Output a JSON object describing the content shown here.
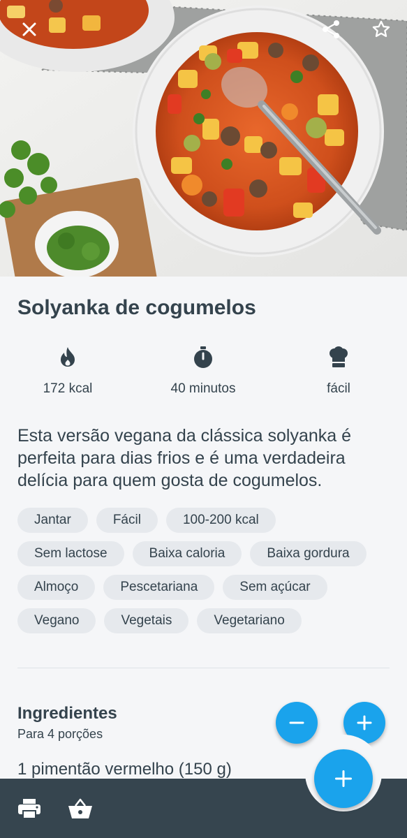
{
  "recipe": {
    "title": "Solyanka de cogumelos",
    "stats": {
      "calories": "172 kcal",
      "time": "40 minutos",
      "difficulty": "fácil"
    },
    "description": "Esta versão vegana da clássica solyanka é perfeita para dias frios e é uma verdadeira delícia para quem gosta de cogumelos.",
    "tags": [
      [
        "Jantar",
        "Fácil",
        "100-200 kcal"
      ],
      [
        "Sem lactose",
        "Baixa caloria",
        "Baixa gordura"
      ],
      [
        "Almoço",
        "Pescetariana",
        "Sem açúcar"
      ],
      [
        "Vegano",
        "Vegetais",
        "Vegetariano"
      ]
    ]
  },
  "ingredients": {
    "title": "Ingredientes",
    "servings": "Para 4 porções",
    "first_item": "1 pimentão vermelho (150 g)"
  },
  "icons": {
    "close": "close-icon",
    "share": "share-icon",
    "favorite": "star-outline-icon",
    "calories": "flame-icon",
    "time": "stopwatch-icon",
    "difficulty": "chef-hat-icon",
    "decrease": "minus-icon",
    "increase": "plus-icon",
    "add": "plus-icon",
    "print": "printer-icon",
    "shopping": "basket-icon"
  },
  "colors": {
    "accent": "#1aa3ec",
    "text": "#34434d",
    "tag_bg": "#e6e9ed",
    "bottom_bar": "#36454f",
    "page_bg": "#f5f6f8"
  }
}
